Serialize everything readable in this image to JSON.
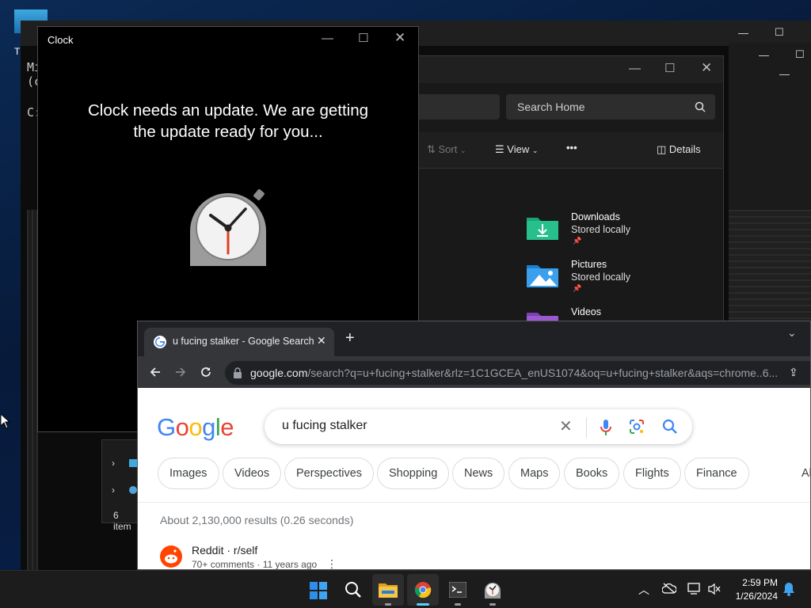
{
  "desktop": {
    "icon_label": "T"
  },
  "terminal": {
    "lines": [
      "Mi",
      "(c",
      "C:"
    ]
  },
  "explorer": {
    "search_placeholder": "Search Home",
    "toolbar": {
      "sort": "Sort",
      "view": "View",
      "more": "•••",
      "details": "Details"
    },
    "quick_access": [
      {
        "name": "Downloads",
        "status": "Stored locally",
        "icon": "downloads-folder-icon"
      },
      {
        "name": "Pictures",
        "status": "Stored locally",
        "icon": "pictures-folder-icon"
      },
      {
        "name": "Videos",
        "status": "",
        "icon": "videos-folder-icon"
      }
    ],
    "item_count": "6 item"
  },
  "clock_app": {
    "title": "Clock",
    "message": "Clock needs an update. We are getting the update ready for you..."
  },
  "chrome": {
    "tab_title": "u fucing stalker - Google Search",
    "url_domain": "google.com",
    "url_path": "/search?q=u+fucing+stalker&rlz=1C1GCEA_enUS1074&oq=u+fucing+stalker&aqs=chrome..6...",
    "logo": "Google",
    "query": "u fucing stalker",
    "chips": [
      "Images",
      "Videos",
      "Perspectives",
      "Shopping",
      "News",
      "Maps",
      "Books",
      "Flights",
      "Finance",
      "Al"
    ],
    "results_stats": "About 2,130,000 results (0.26 seconds)",
    "result": {
      "site": "Reddit · r/self",
      "meta": "70+ comments · 11 years ago"
    }
  },
  "taskbar": {
    "time": "2:59 PM",
    "date": "1/26/2024",
    "apps": [
      "start-icon",
      "search-icon",
      "file-explorer-icon",
      "chrome-icon",
      "terminal-icon",
      "clock-app-icon"
    ]
  },
  "colors": {
    "accent": "#0078d4",
    "google_blue": "#4285F4",
    "google_red": "#EA4335",
    "google_yellow": "#FBBC05",
    "google_green": "#34A853"
  }
}
